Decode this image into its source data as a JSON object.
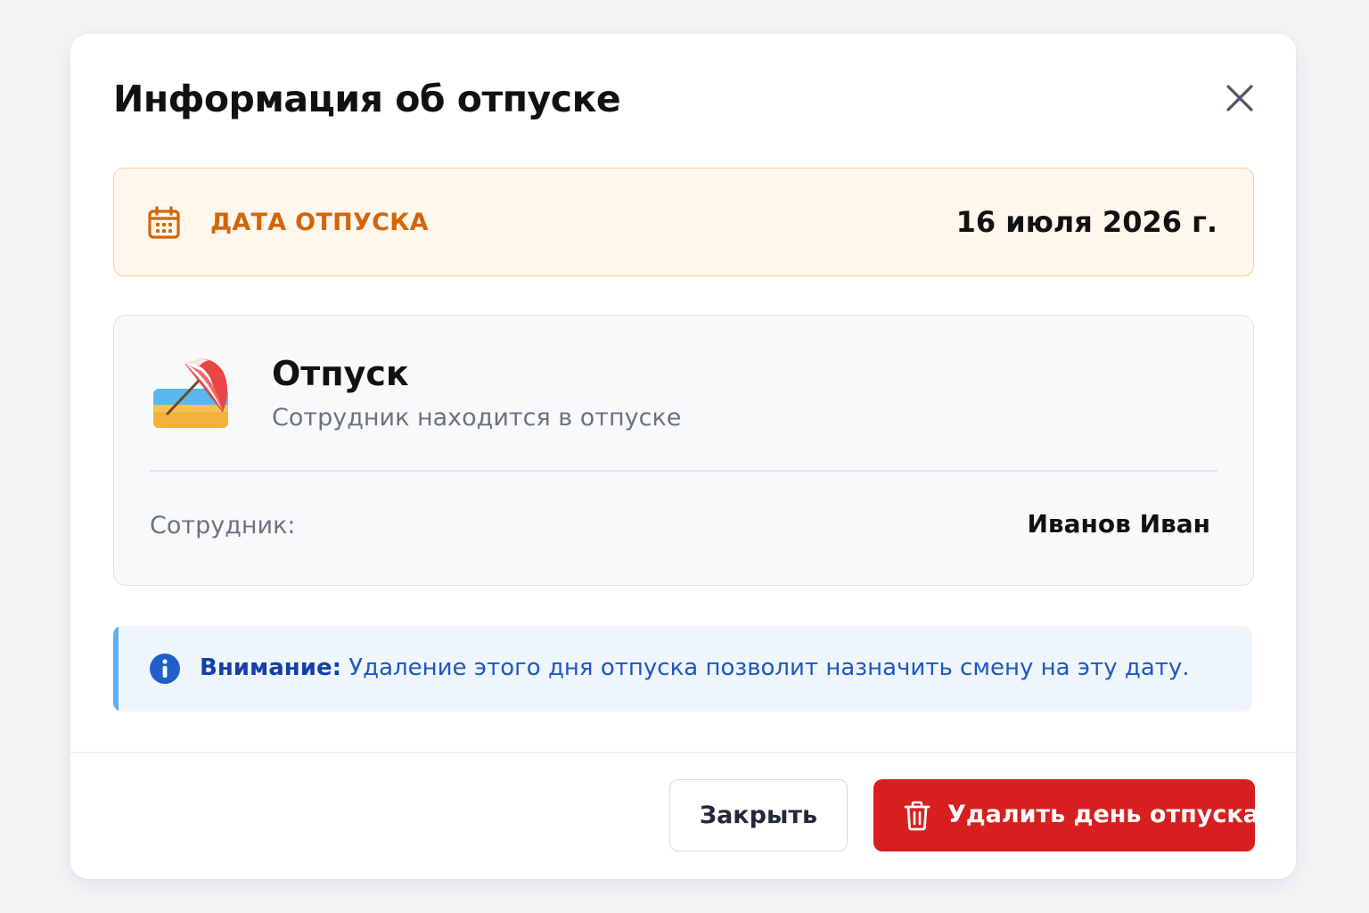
{
  "modal": {
    "title": "Информация об отпуске",
    "close_icon": "close-icon"
  },
  "date_panel": {
    "icon": "calendar-icon",
    "label": "ДАТА ОТПУСКА",
    "value": "16 июля 2026 г.",
    "accent_color": "#d2660b",
    "background_color": "#fff6ec"
  },
  "info_card": {
    "icon": "beach-umbrella-icon",
    "title": "Отпуск",
    "subtitle": "Сотрудник находится в отпуске",
    "employee_label": "Сотрудник:",
    "employee_name": "Иванов Иван"
  },
  "notice": {
    "icon": "info-icon",
    "strong": "Внимание:",
    "text": " Удаление этого дня отпуска позволит назначить смену на эту дату.",
    "accent_color": "#5fb1ee",
    "text_color": "#1f57c3"
  },
  "footer": {
    "close_label": "Закрыть",
    "delete_label": "Удалить день отпуска",
    "delete_icon": "trash-icon",
    "delete_color": "#d81f1f"
  }
}
